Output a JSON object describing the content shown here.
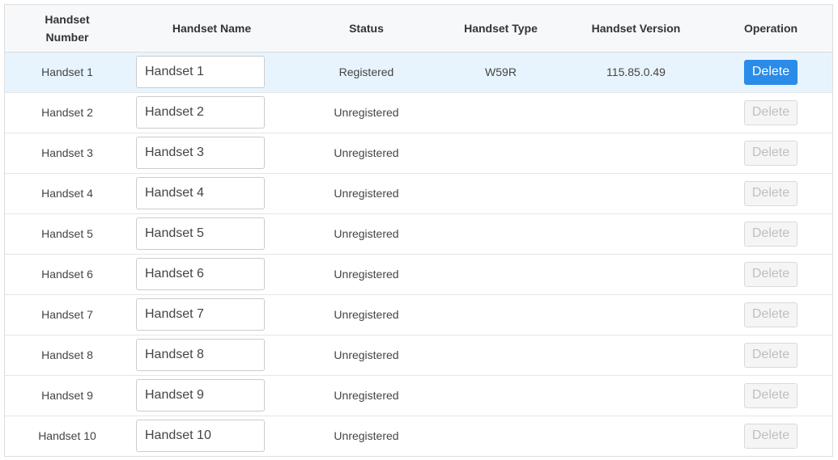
{
  "columns": {
    "number": "Handset Number",
    "name": "Handset Name",
    "status": "Status",
    "type": "Handset Type",
    "version": "Handset Version",
    "operation": "Operation"
  },
  "rows": [
    {
      "number": "Handset 1",
      "name": "Handset 1",
      "status": "Registered",
      "type": "W59R",
      "version": "115.85.0.49",
      "action": "Delete",
      "enabled": true
    },
    {
      "number": "Handset 2",
      "name": "Handset 2",
      "status": "Unregistered",
      "type": "",
      "version": "",
      "action": "Delete",
      "enabled": false
    },
    {
      "number": "Handset 3",
      "name": "Handset 3",
      "status": "Unregistered",
      "type": "",
      "version": "",
      "action": "Delete",
      "enabled": false
    },
    {
      "number": "Handset 4",
      "name": "Handset 4",
      "status": "Unregistered",
      "type": "",
      "version": "",
      "action": "Delete",
      "enabled": false
    },
    {
      "number": "Handset 5",
      "name": "Handset 5",
      "status": "Unregistered",
      "type": "",
      "version": "",
      "action": "Delete",
      "enabled": false
    },
    {
      "number": "Handset 6",
      "name": "Handset 6",
      "status": "Unregistered",
      "type": "",
      "version": "",
      "action": "Delete",
      "enabled": false
    },
    {
      "number": "Handset 7",
      "name": "Handset 7",
      "status": "Unregistered",
      "type": "",
      "version": "",
      "action": "Delete",
      "enabled": false
    },
    {
      "number": "Handset 8",
      "name": "Handset 8",
      "status": "Unregistered",
      "type": "",
      "version": "",
      "action": "Delete",
      "enabled": false
    },
    {
      "number": "Handset 9",
      "name": "Handset 9",
      "status": "Unregistered",
      "type": "",
      "version": "",
      "action": "Delete",
      "enabled": false
    },
    {
      "number": "Handset 10",
      "name": "Handset 10",
      "status": "Unregistered",
      "type": "",
      "version": "",
      "action": "Delete",
      "enabled": false
    }
  ],
  "colors": {
    "accent": "#2b8be8",
    "active_row": "#e8f4fd",
    "header_bg": "#f7f8fa"
  }
}
